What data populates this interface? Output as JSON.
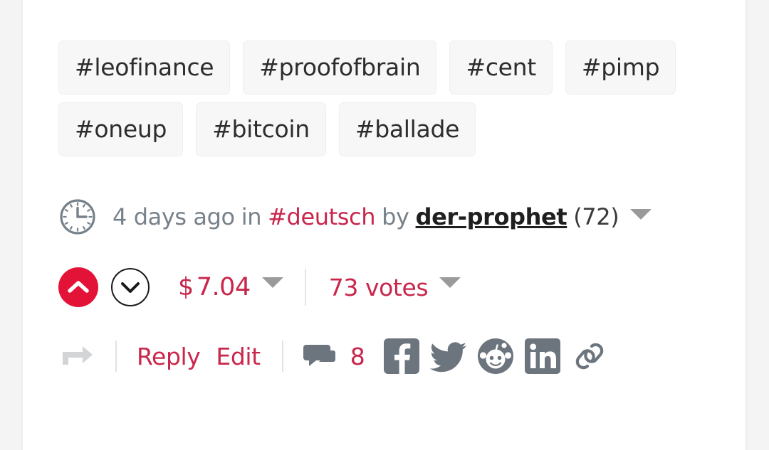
{
  "card": {
    "tags": [
      {
        "name": "tag-leofinance",
        "label": "#leofinance"
      },
      {
        "name": "tag-proofofbrain",
        "label": "#proofofbrain"
      },
      {
        "name": "tag-cent",
        "label": "#cent"
      },
      {
        "name": "tag-pimp",
        "label": "#pimp"
      },
      {
        "name": "tag-oneup",
        "label": "#oneup"
      },
      {
        "name": "tag-bitcoin",
        "label": "#bitcoin"
      },
      {
        "name": "tag-ballade",
        "label": "#ballade"
      }
    ],
    "meta": {
      "clock_icon": "clock-icon",
      "timestamp": "4 days ago",
      "in_word": "in",
      "community": "#deutsch",
      "by_word": "by",
      "author": "der-prophet",
      "reputation": "(72)",
      "caret_icon": "chevron-down-icon"
    },
    "votes": {
      "upvote_icon": "chevron-up-icon",
      "downvote_icon": "chevron-down-icon",
      "payout_currency": "$",
      "payout_amount": "7.04",
      "payout_caret_icon": "chevron-down-icon",
      "votes_label": "73 votes",
      "votes_caret_icon": "chevron-down-icon"
    },
    "actions": {
      "reshare_icon": "reshare-icon",
      "reply_label": "Reply",
      "edit_label": "Edit",
      "comment_icon": "comment-icon",
      "comment_count": "8",
      "social": [
        {
          "name": "facebook-icon",
          "label": "Facebook"
        },
        {
          "name": "twitter-icon",
          "label": "Twitter"
        },
        {
          "name": "reddit-icon",
          "label": "Reddit"
        },
        {
          "name": "linkedin-icon",
          "label": "LinkedIn"
        },
        {
          "name": "link-icon",
          "label": "Copy link"
        }
      ]
    },
    "colors": {
      "accent_red": "#c9264b",
      "upvote_red": "#e31337",
      "meta_gray": "#77818a",
      "icon_gray": "#6c757d",
      "tag_bg": "#f7f7f7",
      "page_bg": "#f4f4f4"
    }
  }
}
